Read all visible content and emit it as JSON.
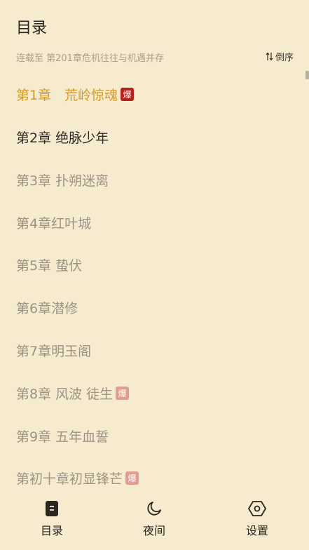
{
  "header": {
    "title": "目录",
    "subtitle": "连载至 第201章危机往往与机遇并存",
    "sort_label": "倒序"
  },
  "chapters": [
    {
      "label": "第1章　荒岭惊魂",
      "badge": "爆",
      "state": "current"
    },
    {
      "label": "第2章 绝脉少年",
      "badge": "",
      "state": "read"
    },
    {
      "label": "第3章 扑朔迷离",
      "badge": "",
      "state": "unread"
    },
    {
      "label": "第4章红叶城",
      "badge": "",
      "state": "unread"
    },
    {
      "label": "第5章 蛰伏",
      "badge": "",
      "state": "unread"
    },
    {
      "label": "第6章潜修",
      "badge": "",
      "state": "unread"
    },
    {
      "label": "第7章明玉阁",
      "badge": "",
      "state": "unread"
    },
    {
      "label": "第8章 风波 徒生",
      "badge": "爆",
      "state": "unread"
    },
    {
      "label": "第9章 五年血誓",
      "badge": "",
      "state": "unread"
    },
    {
      "label": "第初十章初显锋芒",
      "badge": "爆",
      "state": "unread"
    }
  ],
  "bottom_nav": [
    {
      "label": "目录",
      "icon": "toc-icon"
    },
    {
      "label": "夜间",
      "icon": "moon-icon"
    },
    {
      "label": "设置",
      "icon": "settings-icon"
    }
  ],
  "colors": {
    "background": "#f7ebcf",
    "current_chapter": "#d29a24",
    "read_chapter": "#2e2a24",
    "unread_chapter": "#9b9385",
    "badge_hot": "#b3231f",
    "badge_muted": "#e29d92"
  }
}
